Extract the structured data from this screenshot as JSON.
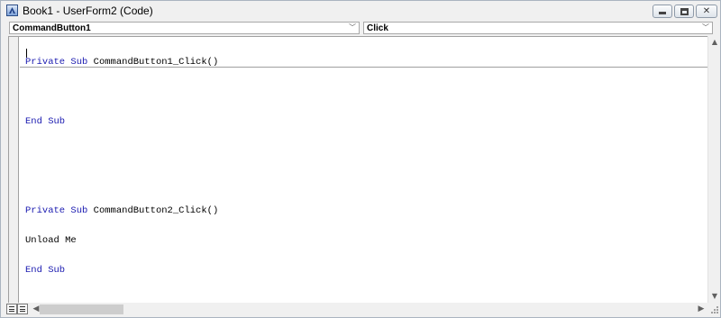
{
  "window": {
    "title": "Book1 - UserForm2 (Code)",
    "controls": {
      "minimize": "",
      "maximize": "",
      "close": "✕"
    }
  },
  "object_combo": {
    "value": "CommandButton1"
  },
  "procedure_combo": {
    "value": "Click"
  },
  "code": {
    "proc1": {
      "kw_private": "Private",
      "kw_sub": "Sub",
      "name": "CommandButton1_Click()",
      "end_line": "End Sub"
    },
    "proc2": {
      "kw_private": "Private",
      "kw_sub": "Sub",
      "name": "CommandButton2_Click()",
      "body": "Unload Me",
      "end_line": "End Sub"
    }
  },
  "colors": {
    "keyword": "#1a1ab0",
    "text": "#000000",
    "background": "#ffffff"
  },
  "icons": {
    "app": "vba-app-icon",
    "combo_arrow": "chevron-down-icon",
    "scroll_up": "scroll-up-arrow-icon",
    "scroll_down": "scroll-down-arrow-icon",
    "scroll_left": "scroll-left-arrow-icon",
    "scroll_right": "scroll-right-arrow-icon",
    "procedure_view": "procedure-view-icon",
    "full_module_view": "full-module-view-icon"
  }
}
